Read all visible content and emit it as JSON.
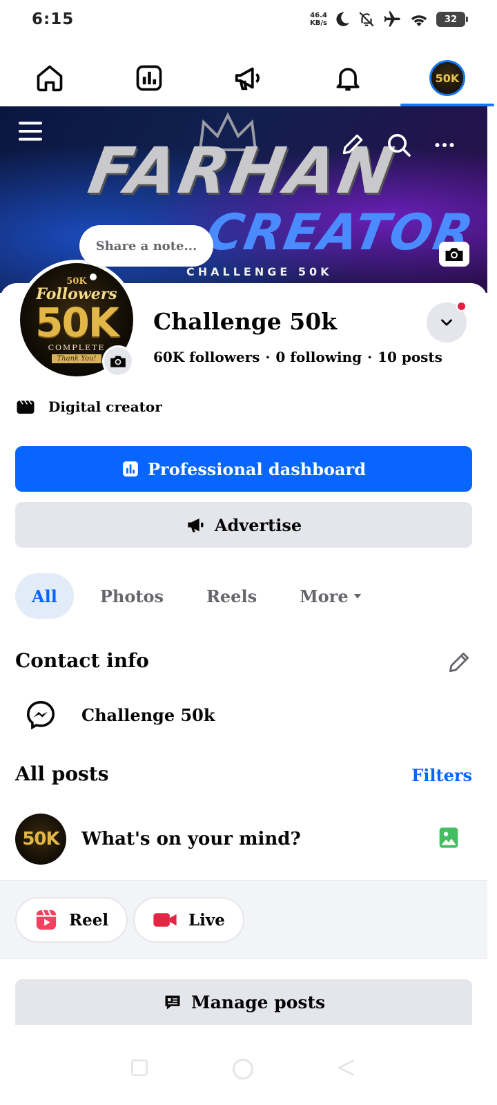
{
  "status_bar": {
    "time": "6:15",
    "net_speed_value": "46.4",
    "net_speed_unit": "KB/s",
    "battery": "32",
    "icons": [
      "moon-icon",
      "bell-off-icon",
      "airplane-icon",
      "wifi-icon",
      "battery-icon"
    ]
  },
  "top_nav": {
    "tabs": [
      {
        "icon": "home-icon"
      },
      {
        "icon": "dashboard-icon"
      },
      {
        "icon": "megaphone-icon"
      },
      {
        "icon": "bell-icon"
      },
      {
        "icon": "profile-avatar",
        "active": true,
        "label": "50K"
      }
    ]
  },
  "cover": {
    "title": "FARHAN",
    "subtitle": "CREATOR",
    "tagline": "CHALLENGE 50K",
    "icons": [
      "menu-icon",
      "pencil-icon",
      "search-icon",
      "more-icon",
      "camera-icon"
    ]
  },
  "note": {
    "placeholder": "Share a note..."
  },
  "avatar": {
    "top": "50K",
    "script": "Followers",
    "big": "50K",
    "complete": "COMPLETE",
    "thanks": "Thank You!"
  },
  "profile": {
    "name": "Challenge 50k",
    "followers": "60K followers",
    "following": "0 following",
    "posts": "10 posts",
    "separator": "·",
    "category": "Digital creator"
  },
  "buttons": {
    "dashboard": "Professional dashboard",
    "advertise": "Advertise",
    "manage_posts": "Manage posts"
  },
  "tabs": {
    "all": "All",
    "photos": "Photos",
    "reels": "Reels",
    "more": "More"
  },
  "contact": {
    "title": "Contact info",
    "messenger_name": "Challenge 50k"
  },
  "posts": {
    "title": "All posts",
    "filters": "Filters",
    "composer_placeholder": "What's on your mind?",
    "reel": "Reel",
    "live": "Live"
  },
  "colors": {
    "accent": "#0866ff",
    "notification": "#e41e3f",
    "photo": "#45bd62",
    "reel": "#f3425f",
    "live": "#e42645"
  }
}
